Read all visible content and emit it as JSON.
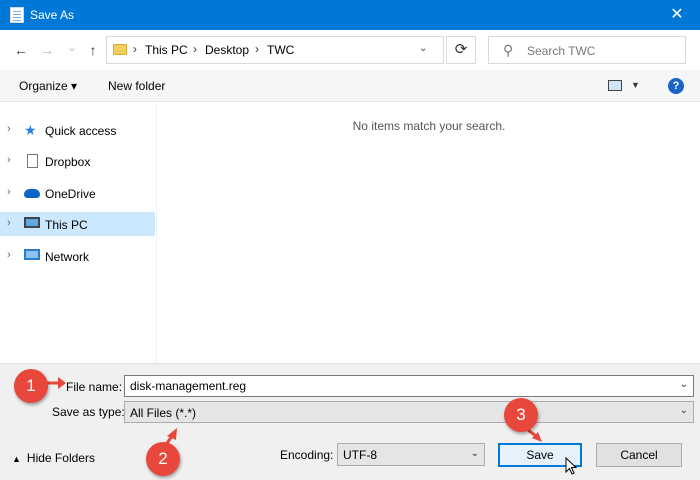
{
  "window": {
    "title": "Save As",
    "close_glyph": "✕"
  },
  "nav": {
    "back_glyph": "←",
    "forward_glyph": "→",
    "recent_glyph": "⌄",
    "up_glyph": "↑",
    "breadcrumb": [
      "This PC",
      "Desktop",
      "TWC"
    ],
    "refresh_glyph": "⟳",
    "search_placeholder": "Search TWC"
  },
  "toolbar": {
    "organize_label": "Organize ▾",
    "new_folder_label": "New folder",
    "help_glyph": "?"
  },
  "sidebar": {
    "items": [
      {
        "label": "Quick access",
        "icon": "star-icon"
      },
      {
        "label": "Dropbox",
        "icon": "document-icon"
      },
      {
        "label": "OneDrive",
        "icon": "cloud-icon"
      },
      {
        "label": "This PC",
        "icon": "computer-icon",
        "selected": true
      },
      {
        "label": "Network",
        "icon": "network-icon"
      }
    ]
  },
  "content": {
    "empty_message": "No items match your search."
  },
  "form": {
    "file_name_label": "File name:",
    "file_name_value": "disk-management.reg",
    "save_as_type_label": "Save as type:",
    "save_as_type_value": "All Files  (*.*)",
    "encoding_label": "Encoding:",
    "encoding_value": "UTF-8",
    "hide_folders_label": "Hide Folders",
    "save_label": "Save",
    "cancel_label": "Cancel"
  },
  "annotations": {
    "step1": "1",
    "step2": "2",
    "step3": "3",
    "color": "#e8473b"
  },
  "colors": {
    "accent": "#0078d7",
    "selection": "#cce8ff"
  }
}
